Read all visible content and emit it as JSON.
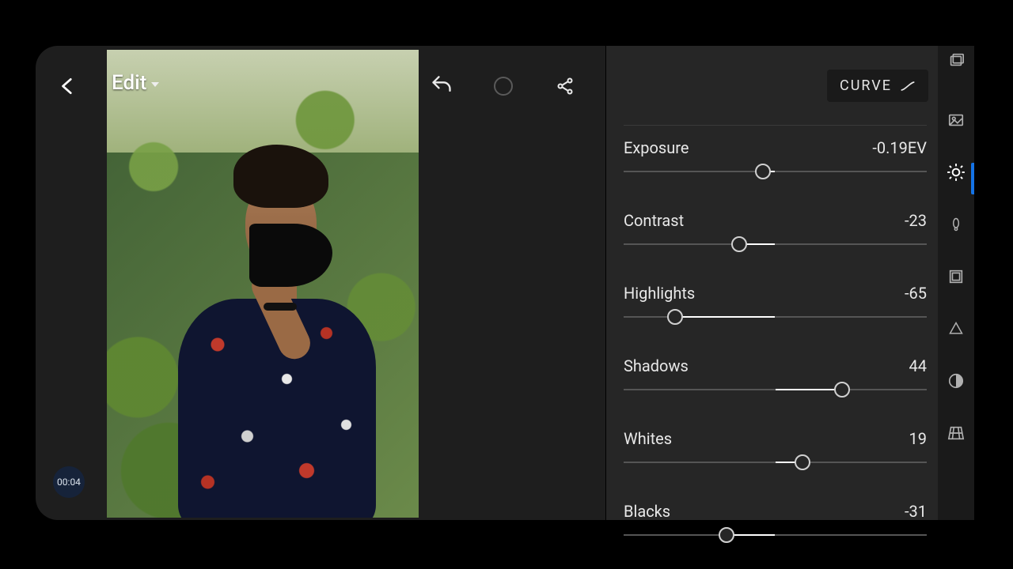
{
  "header": {
    "title": "Edit"
  },
  "curve_button": "CURVE",
  "timer": "00:04",
  "sliders": [
    {
      "label": "Exposure",
      "value_text": "-0.19EV",
      "center": 50,
      "pos": 46
    },
    {
      "label": "Contrast",
      "value_text": "-23",
      "center": 50,
      "pos": 38
    },
    {
      "label": "Highlights",
      "value_text": "-65",
      "center": 50,
      "pos": 17
    },
    {
      "label": "Shadows",
      "value_text": "44",
      "center": 50,
      "pos": 72
    },
    {
      "label": "Whites",
      "value_text": "19",
      "center": 50,
      "pos": 59
    },
    {
      "label": "Blacks",
      "value_text": "-31",
      "center": 50,
      "pos": 34
    }
  ],
  "tools": [
    {
      "name": "gallery"
    },
    {
      "name": "preview"
    },
    {
      "name": "light",
      "active": true
    },
    {
      "name": "color"
    },
    {
      "name": "crop"
    },
    {
      "name": "detail"
    },
    {
      "name": "optics"
    },
    {
      "name": "geometry"
    }
  ]
}
